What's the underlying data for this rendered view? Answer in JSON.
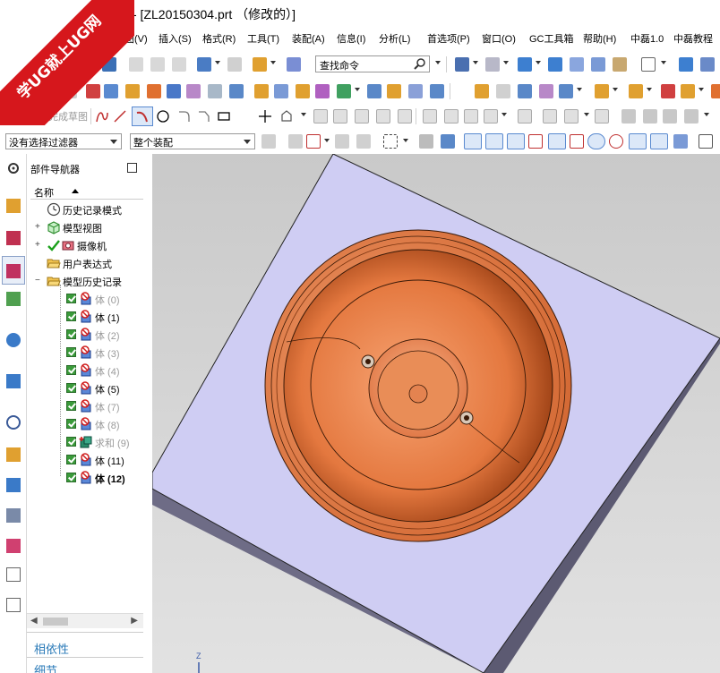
{
  "window": {
    "title": "- [ZL20150304.prt （修改的）]"
  },
  "watermark": {
    "line1": "9SUG",
    "line2": "学UG就上UG网"
  },
  "menu": {
    "items": [
      "视图(V)",
      "插入(S)",
      "格式(R)",
      "工具(T)",
      "装配(A)",
      "信息(I)",
      "分析(L)",
      "首选项(P)",
      "窗口(O)",
      "GC工具箱",
      "帮助(H)",
      "中磊1.0",
      "中磊教程"
    ]
  },
  "toolbar": {
    "search_placeholder": "查找命令",
    "finish_sketch": "完成草图"
  },
  "selection": {
    "filter_value": "没有选择过滤器",
    "scope_value": "整个装配"
  },
  "navigator": {
    "title": "部件导航器",
    "column_name": "名称",
    "items": [
      {
        "label": "历史记录模式",
        "state": "normal"
      },
      {
        "label": "模型视图",
        "state": "normal"
      },
      {
        "label": "摄像机",
        "state": "normal"
      },
      {
        "label": "用户表达式",
        "state": "normal"
      },
      {
        "label": "模型历史记录",
        "state": "normal"
      },
      {
        "label": "体 (0)",
        "state": "dim"
      },
      {
        "label": "体 (1)",
        "state": "normal"
      },
      {
        "label": "体 (2)",
        "state": "dim"
      },
      {
        "label": "体 (3)",
        "state": "dim"
      },
      {
        "label": "体 (4)",
        "state": "dim"
      },
      {
        "label": "体 (5)",
        "state": "normal"
      },
      {
        "label": "体 (7)",
        "state": "dim"
      },
      {
        "label": "体 (8)",
        "state": "dim"
      },
      {
        "label": "求和 (9)",
        "state": "dim"
      },
      {
        "label": "体 (11)",
        "state": "normal"
      },
      {
        "label": "体 (12)",
        "state": "bold"
      }
    ],
    "dependency_label": "相依性",
    "details_label": "细节"
  },
  "colors": {
    "part_orange": "#e0783a",
    "block_lavender": "#cfcdf3",
    "block_side": "#6e6c86",
    "link_blue": "#2a7ab8"
  }
}
